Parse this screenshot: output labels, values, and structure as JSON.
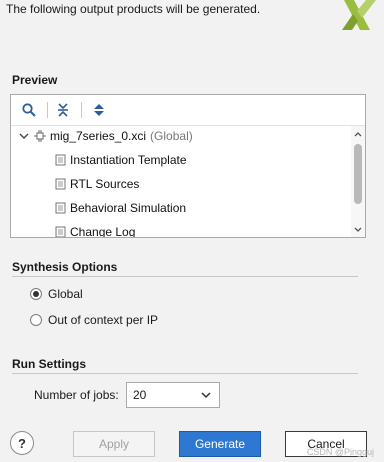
{
  "intro_text": "The following output products will be generated.",
  "preview": {
    "title": "Preview",
    "toolbar": [
      "search-icon",
      "collapse-all-icon",
      "expand-all-icon"
    ],
    "tree": {
      "root": {
        "name": "mig_7series_0.xci",
        "suffix": "(Global)"
      },
      "children": [
        "Instantiation Template",
        "RTL Sources",
        "Behavioral Simulation",
        "Change Log"
      ]
    }
  },
  "synthesis": {
    "title": "Synthesis Options",
    "options": [
      {
        "label": "Global",
        "selected": true
      },
      {
        "label": "Out of context per IP",
        "selected": false
      }
    ]
  },
  "run_settings": {
    "title": "Run Settings",
    "jobs_label": "Number of jobs:",
    "jobs_value": "20"
  },
  "buttons": {
    "help": "?",
    "apply": "Apply",
    "generate": "Generate",
    "cancel": "Cancel"
  },
  "watermark": "CSDN @Pingguj",
  "colors": {
    "primary": "#2f78d2",
    "logo": "#9bbd3f"
  }
}
